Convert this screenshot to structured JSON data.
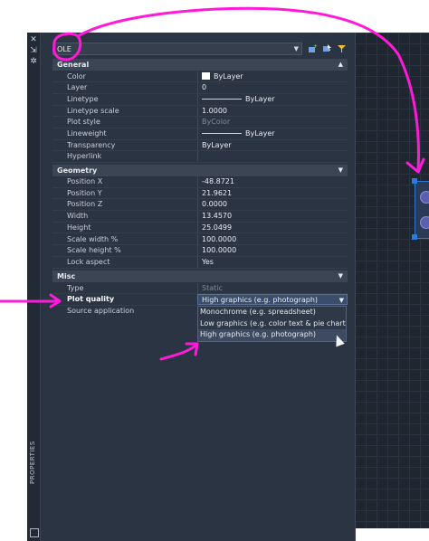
{
  "panel": {
    "object_type": "OLE",
    "vertical_label": "PROPERTIES"
  },
  "sections": {
    "general": {
      "title": "General",
      "rows": [
        {
          "key": "Color",
          "value": "ByLayer"
        },
        {
          "key": "Layer",
          "value": "0"
        },
        {
          "key": "Linetype",
          "value": "ByLayer"
        },
        {
          "key": "Linetype scale",
          "value": "1.0000"
        },
        {
          "key": "Plot style",
          "value": "ByColor"
        },
        {
          "key": "Lineweight",
          "value": "ByLayer"
        },
        {
          "key": "Transparency",
          "value": "ByLayer"
        },
        {
          "key": "Hyperlink",
          "value": ""
        }
      ]
    },
    "geometry": {
      "title": "Geometry",
      "rows": [
        {
          "key": "Position X",
          "value": "-48.8721"
        },
        {
          "key": "Position Y",
          "value": "21.9621"
        },
        {
          "key": "Position Z",
          "value": "0.0000"
        },
        {
          "key": "Width",
          "value": "13.4570"
        },
        {
          "key": "Height",
          "value": "25.0499"
        },
        {
          "key": "Scale width  %",
          "value": "100.0000"
        },
        {
          "key": "Scale height %",
          "value": "100.0000"
        },
        {
          "key": "Lock aspect",
          "value": "Yes"
        }
      ]
    },
    "misc": {
      "title": "Misc",
      "rows": [
        {
          "key": "Type",
          "value": "Static"
        },
        {
          "key": "Plot quality",
          "value": "High graphics (e.g. photograph)"
        },
        {
          "key": "Source application",
          "value": ""
        }
      ]
    }
  },
  "plot_quality_options": [
    "Monochrome (e.g. spreadsheet)",
    "Low graphics (e.g. color text & pie charts)",
    "High graphics (e.g. photograph)"
  ],
  "colors": {
    "annotation": "#ff1ad9",
    "selection": "#2f7ad9",
    "panel_bg": "#2b3442"
  }
}
